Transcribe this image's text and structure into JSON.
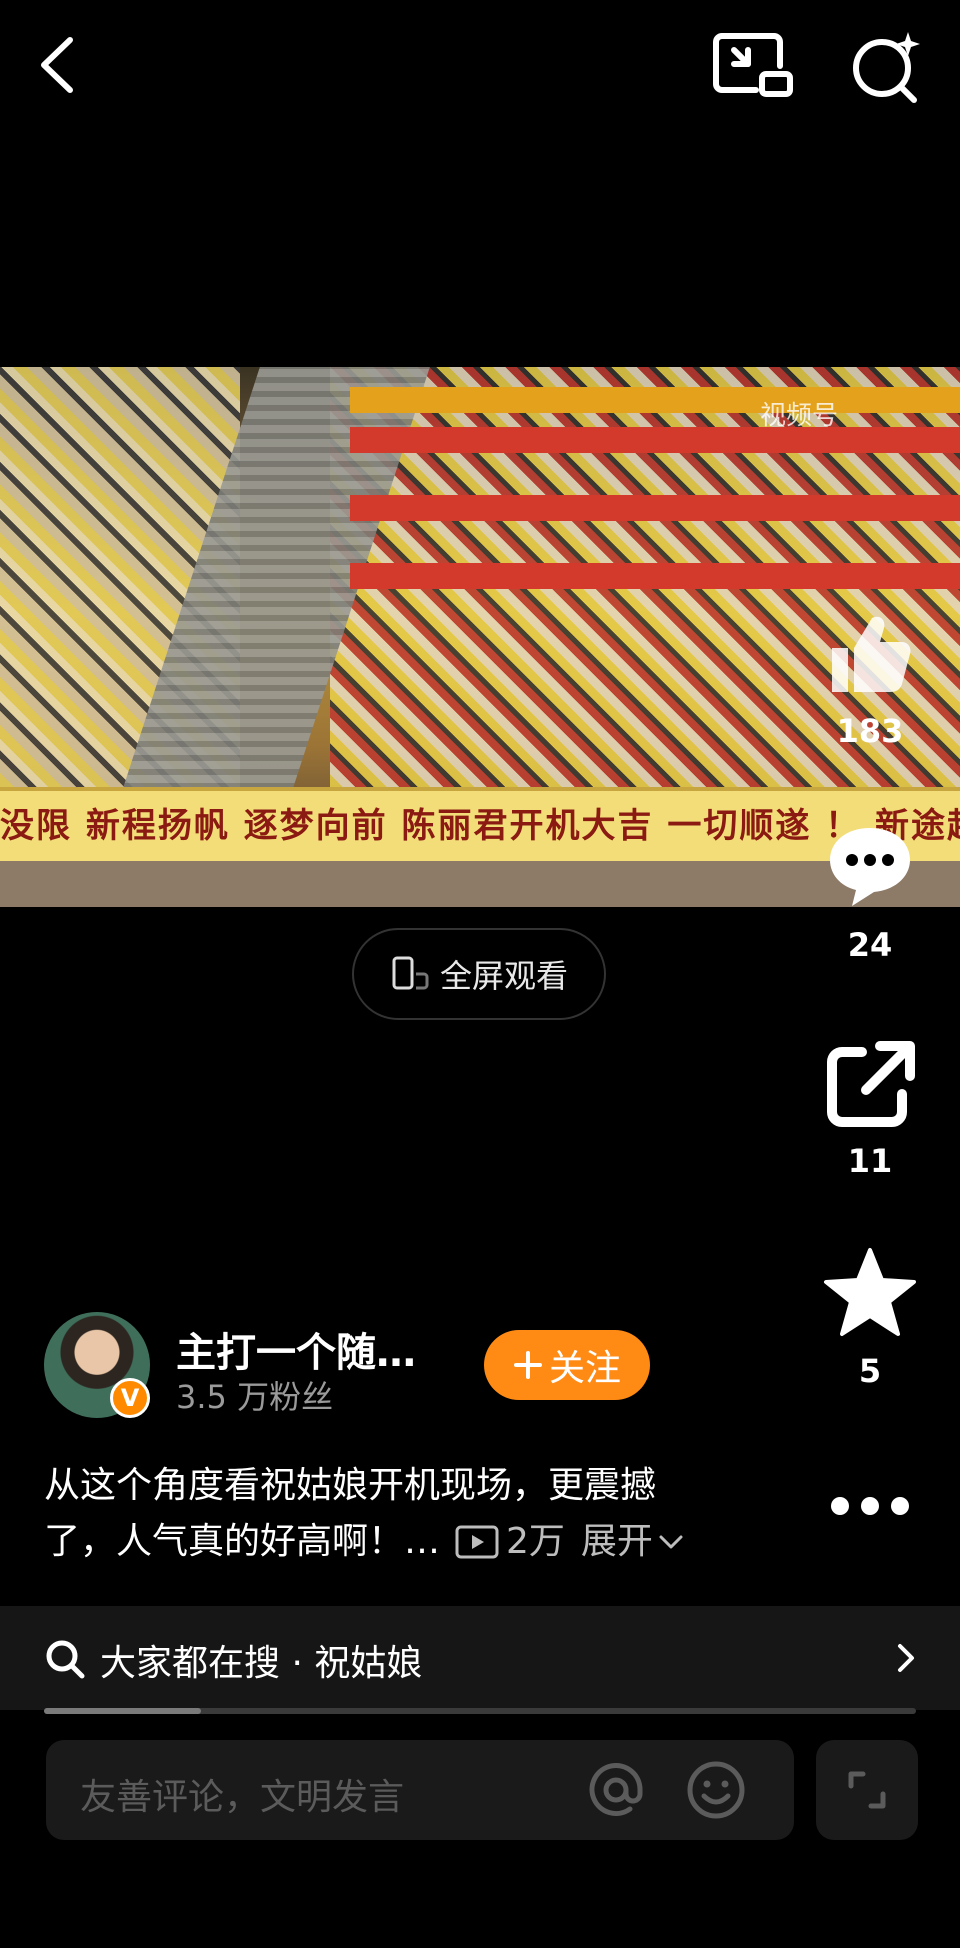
{
  "top_bar": {
    "back_icon": "chevron-left-icon",
    "pip_icon": "picture-in-picture-icon",
    "search_icon": "search-sparkle-icon"
  },
  "video": {
    "watermark": "视频号",
    "banner_text": "没限 新程扬帆 逐梦向前 陈丽君开机大吉 一切顺遂 ！  新途起"
  },
  "fullscreen_button": {
    "label": "全屏观看"
  },
  "rail": {
    "like_count": "183",
    "comment_count": "24",
    "share_count": "11",
    "favorite_count": "5"
  },
  "author": {
    "name": "主打一个随…",
    "fans": "3.5 万粉丝",
    "badge": "V",
    "follow_label": "关注"
  },
  "description": {
    "line1": "从这个角度看祝姑娘开机现场，更震撼",
    "line2": "了，人气真的好高啊！…",
    "play_count": "2万",
    "expand_label": "展开"
  },
  "search_bar": {
    "text": "大家都在搜 · 祝姑娘"
  },
  "playback": {
    "progress": 0.18
  },
  "comment": {
    "placeholder": "友善评论，文明发言"
  },
  "colors": {
    "accent": "#ff8a14",
    "background": "#000000"
  }
}
